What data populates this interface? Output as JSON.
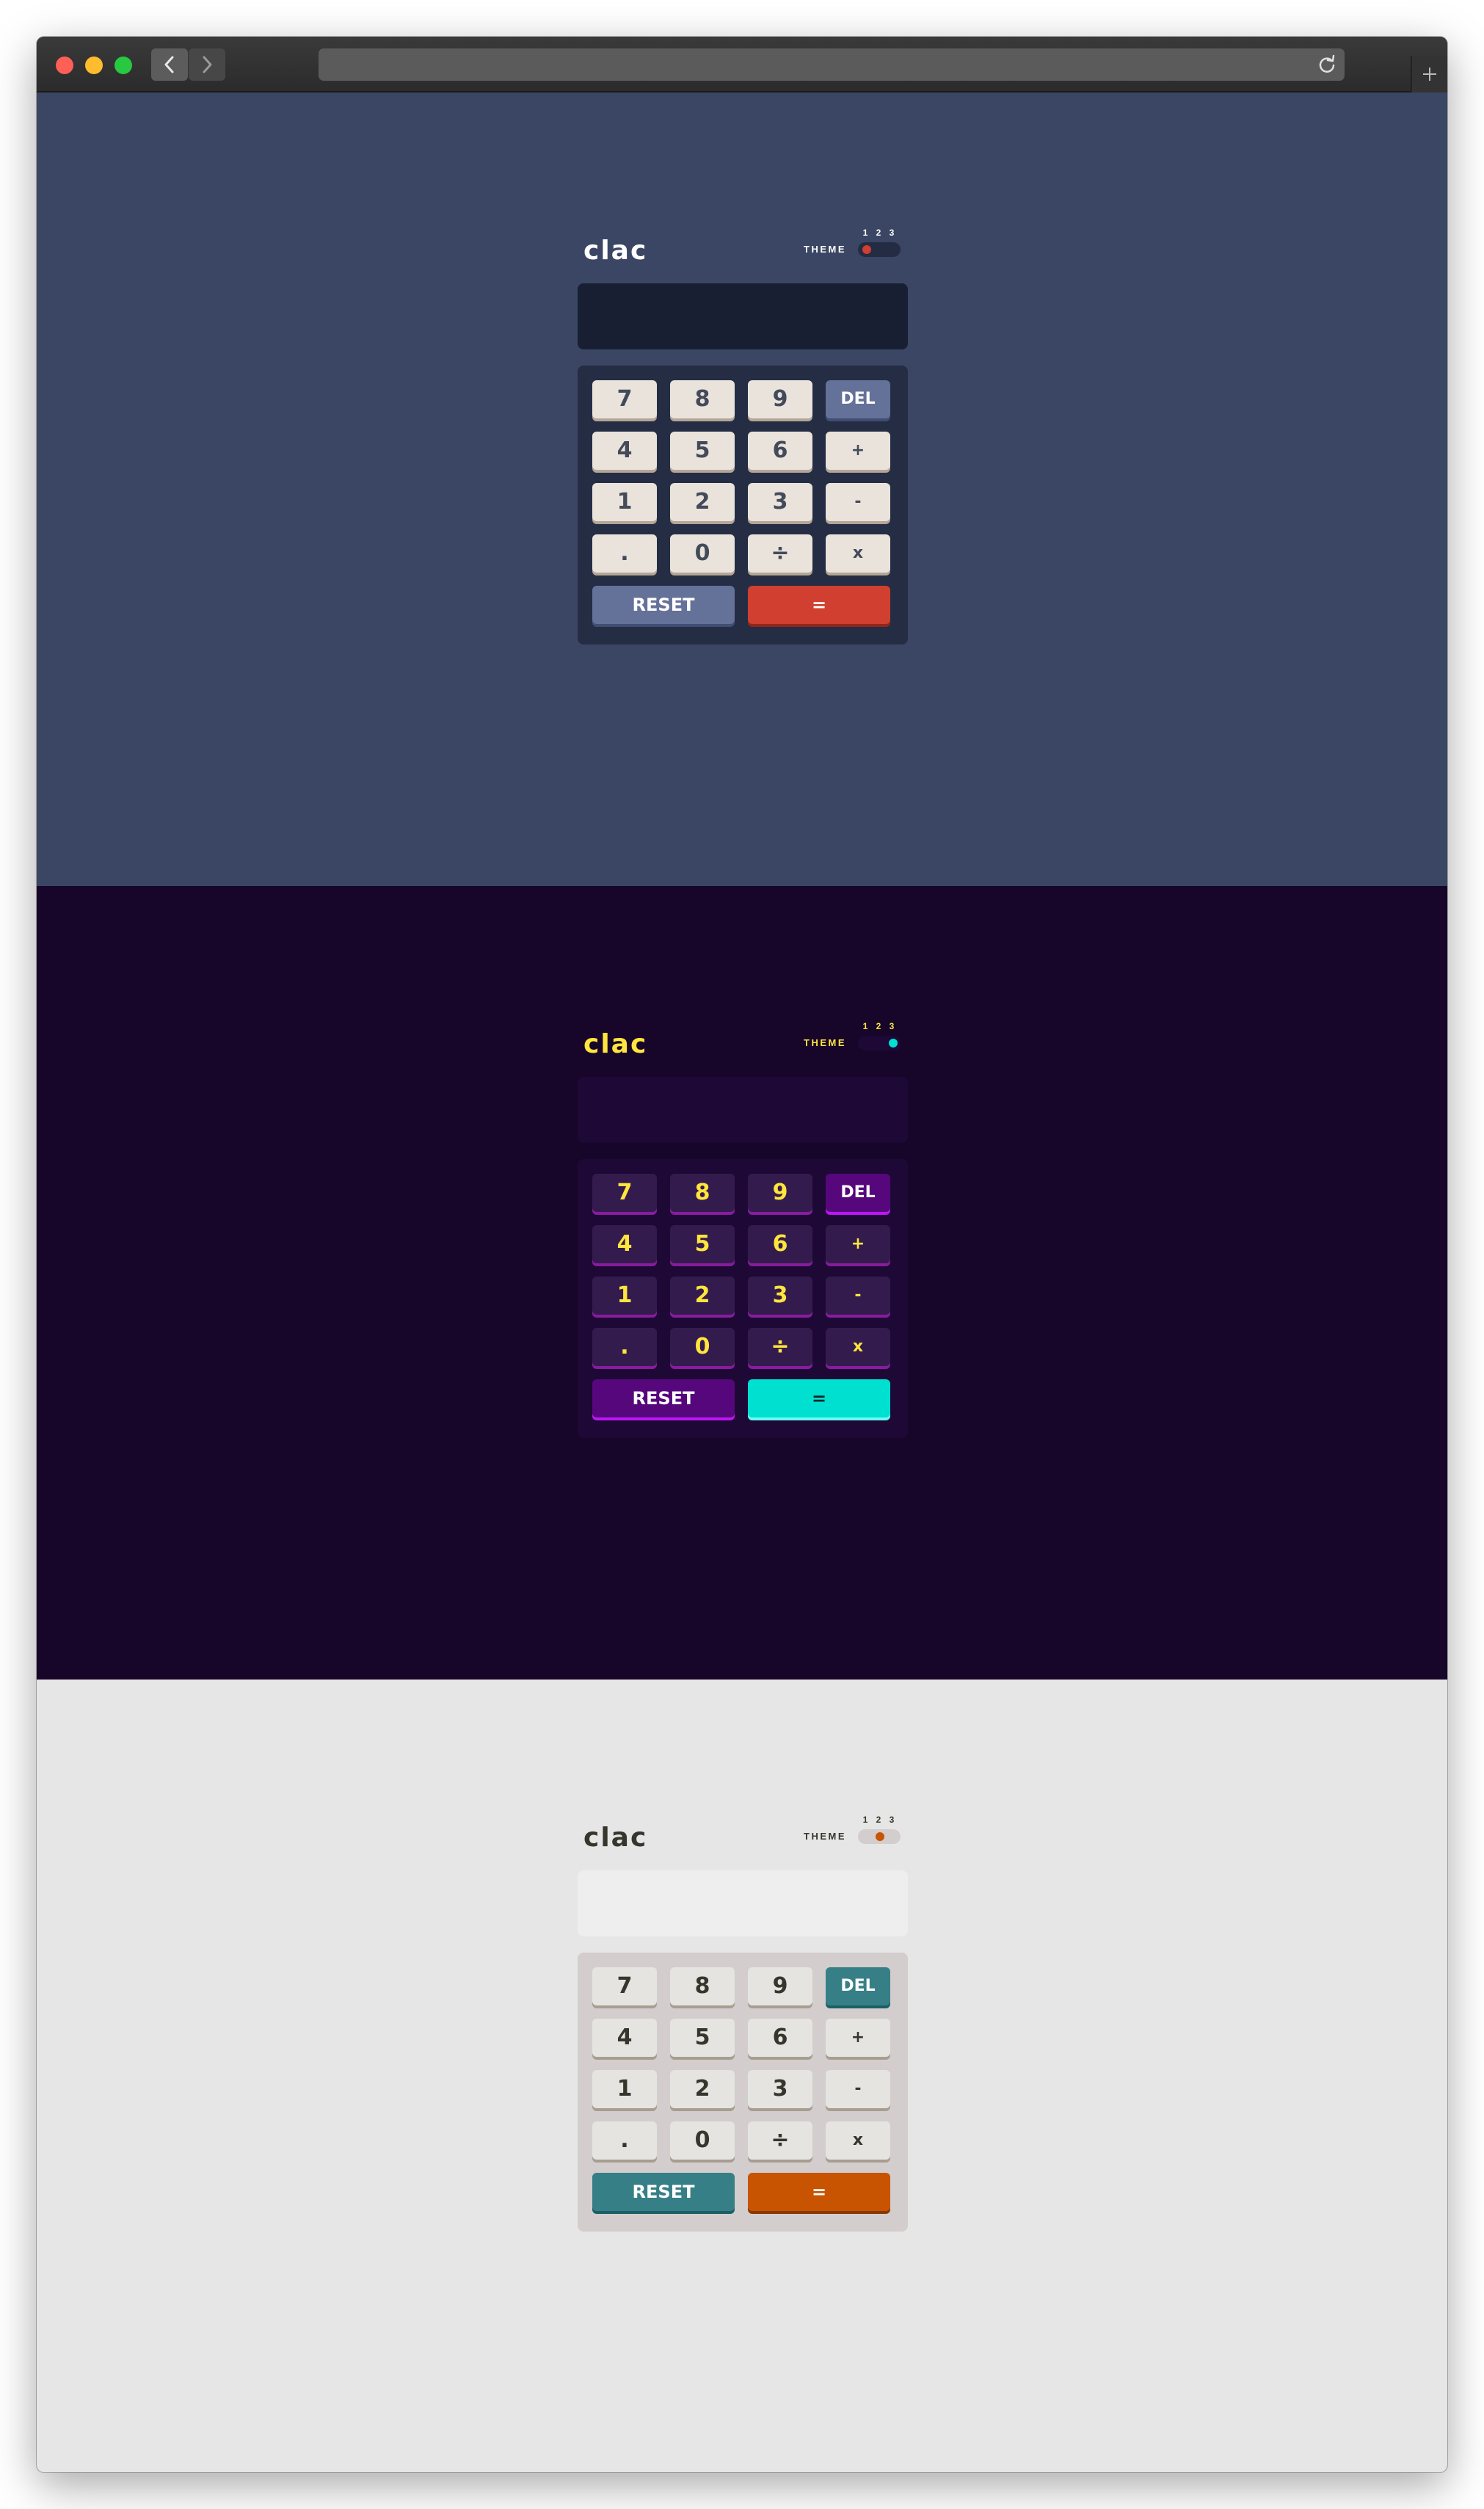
{
  "browser": {
    "icons": {
      "back": "chevron-left-icon",
      "forward": "chevron-right-icon",
      "reload": "reload-icon",
      "new_tab": "plus-icon"
    }
  },
  "calculators": [
    {
      "theme_class": "th1",
      "logo": "clac",
      "theme_label": "THEME",
      "theme_numbers": [
        "1",
        "2",
        "3"
      ],
      "selected_theme": 1,
      "screen_value": "",
      "colors": {
        "background": "#3b4664",
        "accent": "#647198",
        "equals": "#d03f2f"
      }
    },
    {
      "theme_class": "th2",
      "logo": "clac",
      "theme_label": "THEME",
      "theme_numbers": [
        "1",
        "2",
        "3"
      ],
      "selected_theme": 3,
      "screen_value": "",
      "colors": {
        "background": "#17062a",
        "accent": "#56077c",
        "equals": "#00e0d1"
      }
    },
    {
      "theme_class": "th3",
      "logo": "clac",
      "theme_label": "THEME",
      "theme_numbers": [
        "1",
        "2",
        "3"
      ],
      "selected_theme": 2,
      "screen_value": "",
      "colors": {
        "background": "#e6e6e6",
        "accent": "#377f86",
        "equals": "#c85402"
      }
    }
  ],
  "keys": [
    {
      "label": "7",
      "type": "num",
      "name": "key-7"
    },
    {
      "label": "8",
      "type": "num",
      "name": "key-8"
    },
    {
      "label": "9",
      "type": "num",
      "name": "key-9"
    },
    {
      "label": "DEL",
      "type": "acc",
      "name": "delete-button"
    },
    {
      "label": "4",
      "type": "num",
      "name": "key-4"
    },
    {
      "label": "5",
      "type": "num",
      "name": "key-5"
    },
    {
      "label": "6",
      "type": "num",
      "name": "key-6"
    },
    {
      "label": "+",
      "type": "num",
      "name": "add-button"
    },
    {
      "label": "1",
      "type": "num",
      "name": "key-1"
    },
    {
      "label": "2",
      "type": "num",
      "name": "key-2"
    },
    {
      "label": "3",
      "type": "num",
      "name": "key-3"
    },
    {
      "label": "-",
      "type": "num",
      "name": "subtract-button"
    },
    {
      "label": ".",
      "type": "num",
      "name": "decimal-button"
    },
    {
      "label": "0",
      "type": "num",
      "name": "key-0"
    },
    {
      "label": "÷",
      "type": "num",
      "name": "divide-button"
    },
    {
      "label": "x",
      "type": "num",
      "name": "multiply-button"
    },
    {
      "label": "RESET",
      "type": "acc",
      "name": "reset-button"
    },
    {
      "label": "=",
      "type": "eq",
      "name": "equals-button"
    }
  ]
}
